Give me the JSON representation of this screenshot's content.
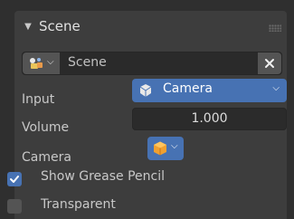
{
  "panel": {
    "title": "Scene",
    "collapse_icon": "triangle-down-icon",
    "grip_icon": "drag-grip-icon"
  },
  "scene_selector": {
    "picker_icon": "scene-data-icon",
    "name": "Scene",
    "close_icon": "close-icon"
  },
  "properties": {
    "input_label": "Input",
    "input_value": "Camera",
    "input_icon": "camera-icon",
    "volume_label": "Volume",
    "volume_value": "1.000",
    "camera_label": "Camera",
    "camera_icon": "camera-object-icon"
  },
  "options": {
    "show_grease_pencil_label": "Show Grease Pencil",
    "show_grease_pencil_checked": true,
    "transparent_label": "Transparent",
    "transparent_checked": false
  },
  "colors": {
    "panel_bg": "#3d3d3d",
    "accent": "#4772b3",
    "field_bg": "#2b2b2b"
  }
}
